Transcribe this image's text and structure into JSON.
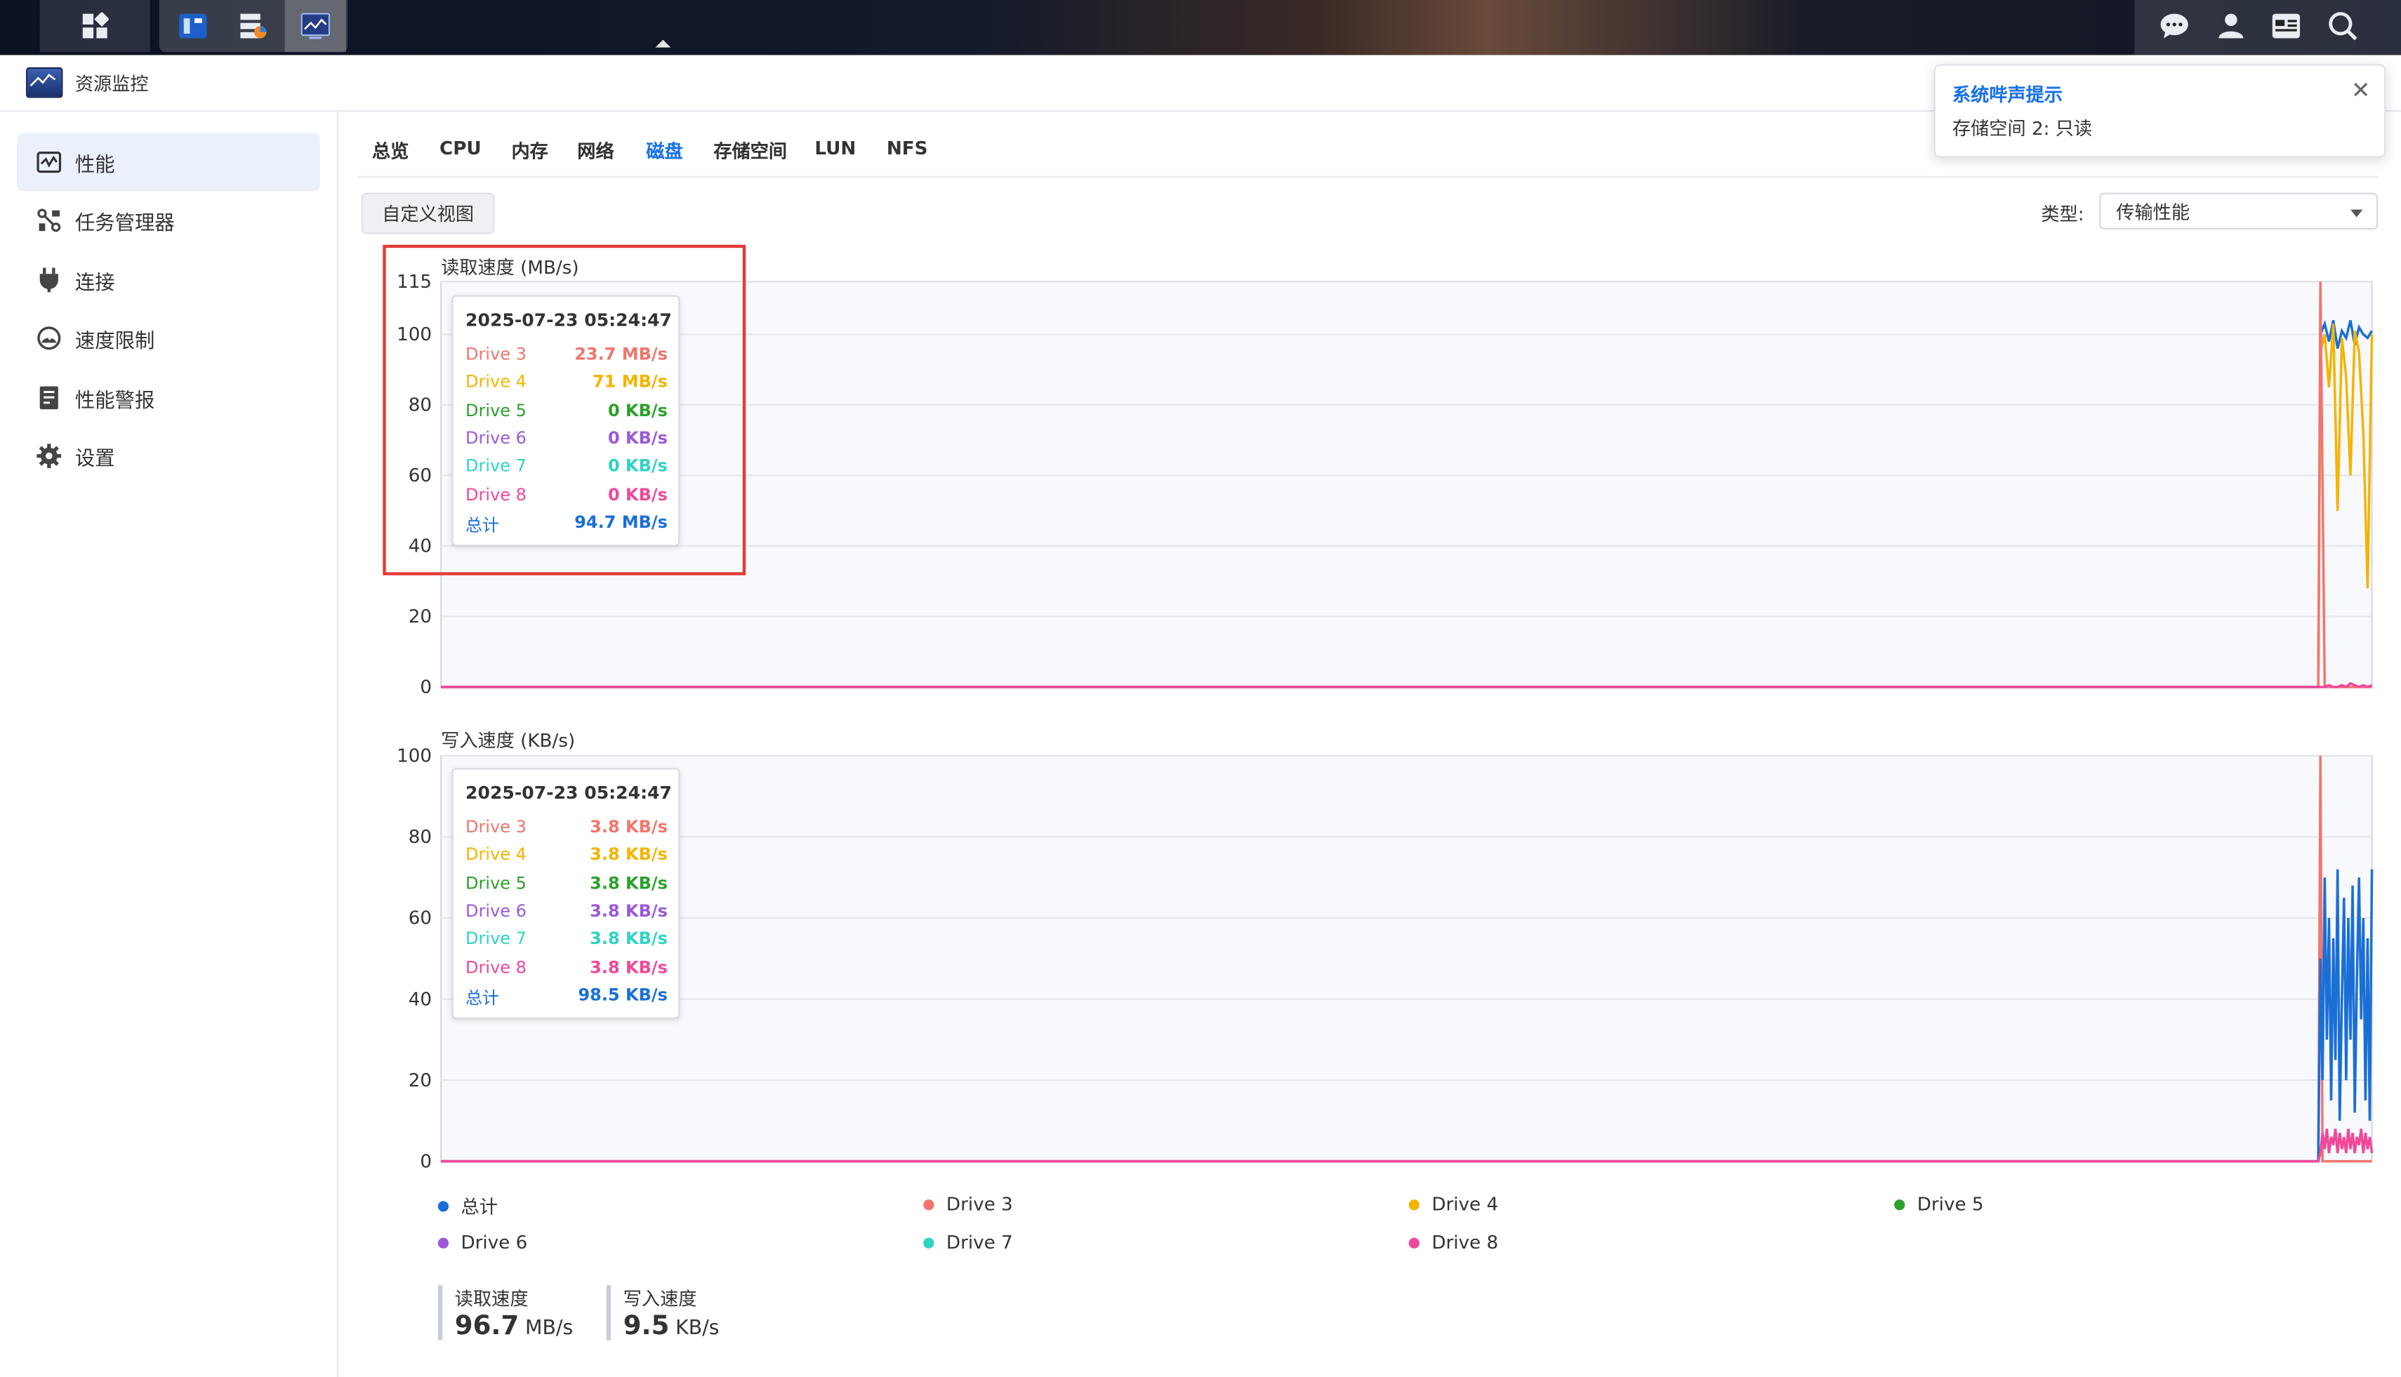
{
  "window": {
    "title": "资源监控"
  },
  "sidebar": {
    "items": [
      {
        "label": "性能",
        "active": true,
        "icon": "performance-icon"
      },
      {
        "label": "任务管理器",
        "active": false,
        "icon": "task-manager-icon"
      },
      {
        "label": "连接",
        "active": false,
        "icon": "plug-icon"
      },
      {
        "label": "速度限制",
        "active": false,
        "icon": "speed-limit-icon"
      },
      {
        "label": "性能警报",
        "active": false,
        "icon": "alert-doc-icon"
      },
      {
        "label": "设置",
        "active": false,
        "icon": "gear-icon"
      }
    ]
  },
  "tabs": [
    {
      "label": "总览",
      "active": false
    },
    {
      "label": "CPU",
      "active": false
    },
    {
      "label": "内存",
      "active": false
    },
    {
      "label": "网络",
      "active": false
    },
    {
      "label": "磁盘",
      "active": true
    },
    {
      "label": "存储空间",
      "active": false
    },
    {
      "label": "LUN",
      "active": false
    },
    {
      "label": "NFS",
      "active": false
    }
  ],
  "toolbar": {
    "custom_view_label": "自定义视图",
    "type_label": "类型:",
    "type_value": "传输性能"
  },
  "notification": {
    "title": "系统哔声提示",
    "message": "存储空间 2:  只读",
    "close_label": "✕"
  },
  "colors": {
    "total": "#1a6fd6",
    "drive3": "#f2756c",
    "drive4": "#f4b400",
    "drive5": "#2ca02c",
    "drive6": "#9b59d6",
    "drive7": "#2ed3c6",
    "drive8": "#f0489a"
  },
  "read_tooltip": {
    "time": "2025-07-23 05:24:47",
    "rows": [
      {
        "name": "Drive 3",
        "value": "23.7 MB/s"
      },
      {
        "name": "Drive 4",
        "value": "71 MB/s"
      },
      {
        "name": "Drive 5",
        "value": "0 KB/s"
      },
      {
        "name": "Drive 6",
        "value": "0 KB/s"
      },
      {
        "name": "Drive 7",
        "value": "0 KB/s"
      },
      {
        "name": "Drive 8",
        "value": "0 KB/s"
      },
      {
        "name": "总计",
        "value": "94.7 MB/s"
      }
    ]
  },
  "write_tooltip": {
    "time": "2025-07-23 05:24:47",
    "rows": [
      {
        "name": "Drive 3",
        "value": "3.8 KB/s"
      },
      {
        "name": "Drive 4",
        "value": "3.8 KB/s"
      },
      {
        "name": "Drive 5",
        "value": "3.8 KB/s"
      },
      {
        "name": "Drive 6",
        "value": "3.8 KB/s"
      },
      {
        "name": "Drive 7",
        "value": "3.8 KB/s"
      },
      {
        "name": "Drive 8",
        "value": "3.8 KB/s"
      },
      {
        "name": "总计",
        "value": "98.5 KB/s"
      }
    ]
  },
  "legend": [
    {
      "name": "总计",
      "color_key": "total"
    },
    {
      "name": "Drive 3",
      "color_key": "drive3"
    },
    {
      "name": "Drive 4",
      "color_key": "drive4"
    },
    {
      "name": "Drive 5",
      "color_key": "drive5"
    },
    {
      "name": "Drive 6",
      "color_key": "drive6"
    },
    {
      "name": "Drive 7",
      "color_key": "drive7"
    },
    {
      "name": "Drive 8",
      "color_key": "drive8"
    }
  ],
  "summary": {
    "read_label": "读取速度",
    "read_value": "96.7",
    "read_unit": "MB/s",
    "write_label": "写入速度",
    "write_value": "9.5",
    "write_unit": "KB/s"
  },
  "chart_data": [
    {
      "type": "line",
      "title": "读取速度 (MB/s)",
      "ylim": [
        0,
        115
      ],
      "yticks": [
        0,
        20,
        40,
        60,
        80,
        100,
        115
      ],
      "grid": true,
      "x_window_seconds": 180,
      "x": [
        0,
        175,
        175.2,
        175.6,
        176,
        176.4,
        176.8,
        177.2,
        177.6,
        178,
        178.4,
        178.8,
        179.2,
        179.6,
        180
      ],
      "series": [
        {
          "name": "总计",
          "color_key": "total",
          "values": [
            0,
            0,
            100,
            103,
            98,
            104,
            96,
            101,
            99,
            104,
            97,
            102,
            100,
            99,
            101
          ]
        },
        {
          "name": "Drive 4",
          "color_key": "drive4",
          "values": [
            0,
            0,
            95,
            100,
            85,
            103,
            50,
            99,
            88,
            60,
            101,
            95,
            72,
            28,
            100
          ]
        },
        {
          "name": "Drive 3",
          "color_key": "drive3",
          "values": [
            0,
            0,
            115,
            0,
            0,
            0,
            0,
            0,
            0,
            0,
            0,
            0,
            0,
            0,
            0
          ]
        },
        {
          "name": "Drive 8",
          "color_key": "drive8",
          "values": [
            0,
            0,
            0,
            0,
            0.5,
            0,
            0,
            0.5,
            0,
            1,
            0.5,
            0,
            0.5,
            0,
            0.5
          ]
        }
      ]
    },
    {
      "type": "line",
      "title": "写入速度 (KB/s)",
      "ylim": [
        0,
        100
      ],
      "yticks": [
        0,
        20,
        40,
        60,
        80,
        100
      ],
      "grid": true,
      "x_window_seconds": 180,
      "x": [
        0,
        175,
        175.2,
        175.4,
        175.6,
        175.8,
        176,
        176.2,
        176.4,
        176.6,
        176.8,
        177,
        177.2,
        177.4,
        177.6,
        177.8,
        178,
        178.2,
        178.4,
        178.6,
        178.8,
        179,
        179.2,
        179.4,
        179.6,
        179.8,
        180
      ],
      "series": [
        {
          "name": "Drive 3",
          "color_key": "drive3",
          "values": [
            0,
            0,
            100,
            0,
            0,
            0,
            0,
            0,
            0,
            0,
            0,
            0,
            0,
            0,
            0,
            0,
            0,
            0,
            0,
            0,
            0,
            0,
            0,
            0,
            0,
            0,
            0
          ]
        },
        {
          "name": "总计",
          "color_key": "total",
          "values": [
            0,
            0,
            50,
            20,
            70,
            30,
            60,
            15,
            55,
            25,
            72,
            10,
            40,
            65,
            20,
            60,
            30,
            68,
            12,
            45,
            70,
            35,
            60,
            15,
            55,
            10,
            72
          ]
        },
        {
          "name": "Drive 8",
          "color_key": "drive8",
          "values": [
            0,
            0,
            2,
            7,
            3,
            8,
            2,
            6,
            4,
            8,
            2,
            7,
            3,
            6,
            2,
            8,
            3,
            7,
            2,
            6,
            4,
            8,
            2,
            7,
            3,
            6,
            2
          ]
        }
      ]
    }
  ]
}
